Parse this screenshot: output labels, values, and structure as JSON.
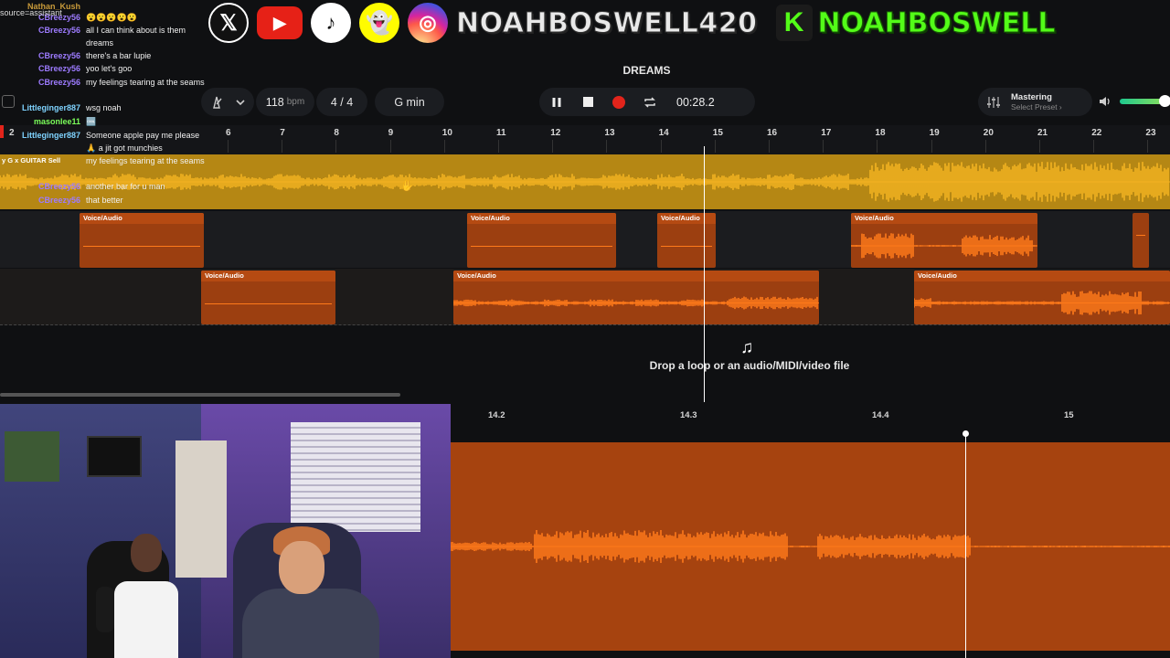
{
  "social": {
    "x_icon": "x-logo-icon",
    "youtube_icon": "youtube-icon",
    "tiktok_icon": "tiktok-icon",
    "snapchat_icon": "snapchat-icon",
    "instagram_icon": "instagram-icon",
    "handle": "NOAHBOSWELL420",
    "kick_letter": "K",
    "kick_handle": "NOAHBOSWELL"
  },
  "chat": [
    {
      "user": "Nathan_Kush",
      "msg": "",
      "color": "#c89a3a"
    },
    {
      "user": "CBreezy56",
      "msg": "😮😮😮😮😮",
      "color": "#9d7bff"
    },
    {
      "user": "CBreezy56",
      "msg": "all I can think about is them dreams",
      "color": "#9d7bff"
    },
    {
      "user": "CBreezy56",
      "msg": "there's a bar lupie",
      "color": "#9d7bff"
    },
    {
      "user": "CBreezy56",
      "msg": "yoo let's goo",
      "color": "#9d7bff"
    },
    {
      "user": "CBreezy56",
      "msg": "my feelings tearing at the seams",
      "color": "#9d7bff"
    },
    {
      "user": "Littleginger887",
      "msg": "wsg noah",
      "color": "#7fd3ff"
    },
    {
      "user": "masonlee11",
      "msg": "🆒",
      "color": "#7cff5b"
    },
    {
      "user": "Littleginger887",
      "msg": "Someone apple pay me please",
      "color": "#7fd3ff"
    },
    {
      "user": "",
      "msg": "🙏 a jit got munchies",
      "color": "#ffffff"
    },
    {
      "user": "",
      "msg": "my feelings tearing at the seams",
      "color": "#ffffff"
    },
    {
      "user": "CBreezy56",
      "msg": "another bar for u man",
      "color": "#9d7bff"
    },
    {
      "user": "CBreezy56",
      "msg": "that better",
      "color": "#9d7bff"
    }
  ],
  "chat_overlay_fragment": "source=assistant",
  "toolbar": {
    "project_title": "DREAMS",
    "tempo_value": "118",
    "tempo_unit": "bpm",
    "time_sig": "4 / 4",
    "key": "G min",
    "time": "00:28.2",
    "mastering_label": "Mastering",
    "mastering_preset": "Select Preset ›",
    "track_badge": "2",
    "track_name_overlay": "y G x GUITAR",
    "track_name_overlay_2": "Sell"
  },
  "ruler": {
    "labels": [
      "6",
      "7",
      "8",
      "9",
      "10",
      "11",
      "12",
      "13",
      "14",
      "15",
      "16",
      "17",
      "18",
      "19",
      "20",
      "21",
      "22",
      "23"
    ]
  },
  "clips": {
    "label": "Voice/Audio"
  },
  "drop_zone": {
    "text": "Drop a loop or an audio/MIDI/video file"
  },
  "editor": {
    "ruler_labels": [
      "14.2",
      "14.3",
      "14.4",
      "15"
    ]
  },
  "colors": {
    "track1": "#b58714",
    "clip": "#9c3f10",
    "accent_orange": "#ff7a1a",
    "record": "#e2241b",
    "kick_green": "#53fc18"
  }
}
